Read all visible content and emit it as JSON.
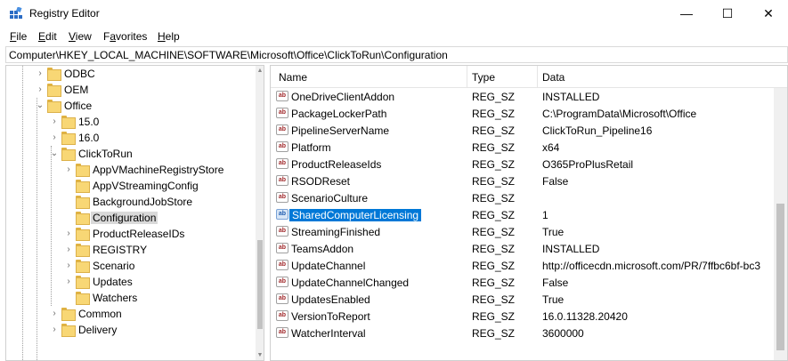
{
  "window": {
    "title": "Registry Editor",
    "icon": "registry-editor-icon",
    "controls": {
      "minimize": "—",
      "maximize": "☐",
      "close": "✕"
    }
  },
  "menu": [
    {
      "accel": "F",
      "rest": "ile"
    },
    {
      "accel": "E",
      "rest": "dit"
    },
    {
      "accel": "V",
      "rest": "iew"
    },
    {
      "accel": "",
      "rest": "Favorites",
      "accel_after": "a"
    },
    {
      "accel": "H",
      "rest": "elp"
    }
  ],
  "menu_labels": {
    "favorites_pre": "F",
    "favorites_accel": "a",
    "favorites_post": "vorites"
  },
  "address": "Computer\\HKEY_LOCAL_MACHINE\\SOFTWARE\\Microsoft\\Office\\ClickToRun\\Configuration",
  "tree": [
    {
      "label": "ODBC",
      "expander": "›"
    },
    {
      "label": "OEM",
      "expander": "›"
    },
    {
      "label": "Office",
      "expander": "⌄"
    },
    {
      "label": "15.0",
      "expander": "›"
    },
    {
      "label": "16.0",
      "expander": "›"
    },
    {
      "label": "ClickToRun",
      "expander": "⌄"
    },
    {
      "label": "AppVMachineRegistryStore",
      "expander": "›"
    },
    {
      "label": "AppVStreamingConfig",
      "expander": ""
    },
    {
      "label": "BackgroundJobStore",
      "expander": ""
    },
    {
      "label": "Configuration",
      "expander": "",
      "selected": true
    },
    {
      "label": "ProductReleaseIDs",
      "expander": "›"
    },
    {
      "label": "REGISTRY",
      "expander": "›"
    },
    {
      "label": "Scenario",
      "expander": "›"
    },
    {
      "label": "Updates",
      "expander": "›"
    },
    {
      "label": "Watchers",
      "expander": ""
    },
    {
      "label": "Common",
      "expander": "›"
    },
    {
      "label": "Delivery",
      "expander": "›"
    }
  ],
  "columns": {
    "name": "Name",
    "type": "Type",
    "data": "Data"
  },
  "values": [
    {
      "name": "OneDriveClientAddon",
      "type": "REG_SZ",
      "data": "INSTALLED"
    },
    {
      "name": "PackageLockerPath",
      "type": "REG_SZ",
      "data": "C:\\ProgramData\\Microsoft\\Office"
    },
    {
      "name": "PipelineServerName",
      "type": "REG_SZ",
      "data": "ClickToRun_Pipeline16"
    },
    {
      "name": "Platform",
      "type": "REG_SZ",
      "data": "x64"
    },
    {
      "name": "ProductReleaseIds",
      "type": "REG_SZ",
      "data": "O365ProPlusRetail"
    },
    {
      "name": "RSODReset",
      "type": "REG_SZ",
      "data": "False"
    },
    {
      "name": "ScenarioCulture",
      "type": "REG_SZ",
      "data": ""
    },
    {
      "name": "SharedComputerLicensing",
      "type": "REG_SZ",
      "data": "1",
      "selected": true
    },
    {
      "name": "StreamingFinished",
      "type": "REG_SZ",
      "data": "True"
    },
    {
      "name": "TeamsAddon",
      "type": "REG_SZ",
      "data": "INSTALLED"
    },
    {
      "name": "UpdateChannel",
      "type": "REG_SZ",
      "data": "http://officecdn.microsoft.com/PR/7ffbc6bf-bc3"
    },
    {
      "name": "UpdateChannelChanged",
      "type": "REG_SZ",
      "data": "False"
    },
    {
      "name": "UpdatesEnabled",
      "type": "REG_SZ",
      "data": "True"
    },
    {
      "name": "VersionToReport",
      "type": "REG_SZ",
      "data": "16.0.11328.20420"
    },
    {
      "name": "WatcherInterval",
      "type": "REG_SZ",
      "data": "3600000"
    }
  ],
  "value_icon_glyph": "ab",
  "colors": {
    "selection": "#0078d7",
    "tree_selection": "#d9d9d9",
    "folder": "#f8d775"
  }
}
